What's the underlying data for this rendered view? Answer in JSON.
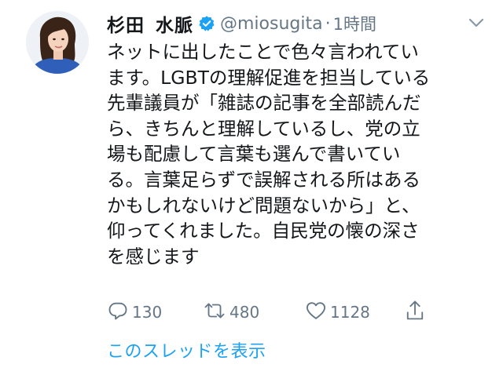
{
  "author": {
    "display_name_family": "杉田",
    "display_name_given": "水脈",
    "handle": "@miosugita",
    "separator": "·",
    "time": "1時間"
  },
  "tweet": {
    "lines": [
      "ネットに出したことで色々言われてい",
      "ます。LGBTの理解促進を担当している",
      "先輩議員が「雑誌の記事を全部読んだ",
      "ら、きちんと理解しているし、党の立",
      "場も配慮して言葉も選んで書いてい",
      "る。言葉足らずで誤解される所はある",
      "かもしれないけど問題ないから」と、",
      "仰ってくれました。自民党の懐の深さ",
      "を感じます"
    ]
  },
  "actions": {
    "reply_count": "130",
    "retweet_count": "480",
    "like_count": "1128"
  },
  "thread_link": "このスレッドを表示",
  "icons": {
    "verified": "verified-badge-icon",
    "caret": "chevron-down-icon",
    "reply": "reply-icon",
    "retweet": "retweet-icon",
    "like": "heart-icon",
    "share": "share-icon"
  },
  "colors": {
    "accent": "#1da1f2",
    "muted": "#657786",
    "text": "#14171a"
  }
}
